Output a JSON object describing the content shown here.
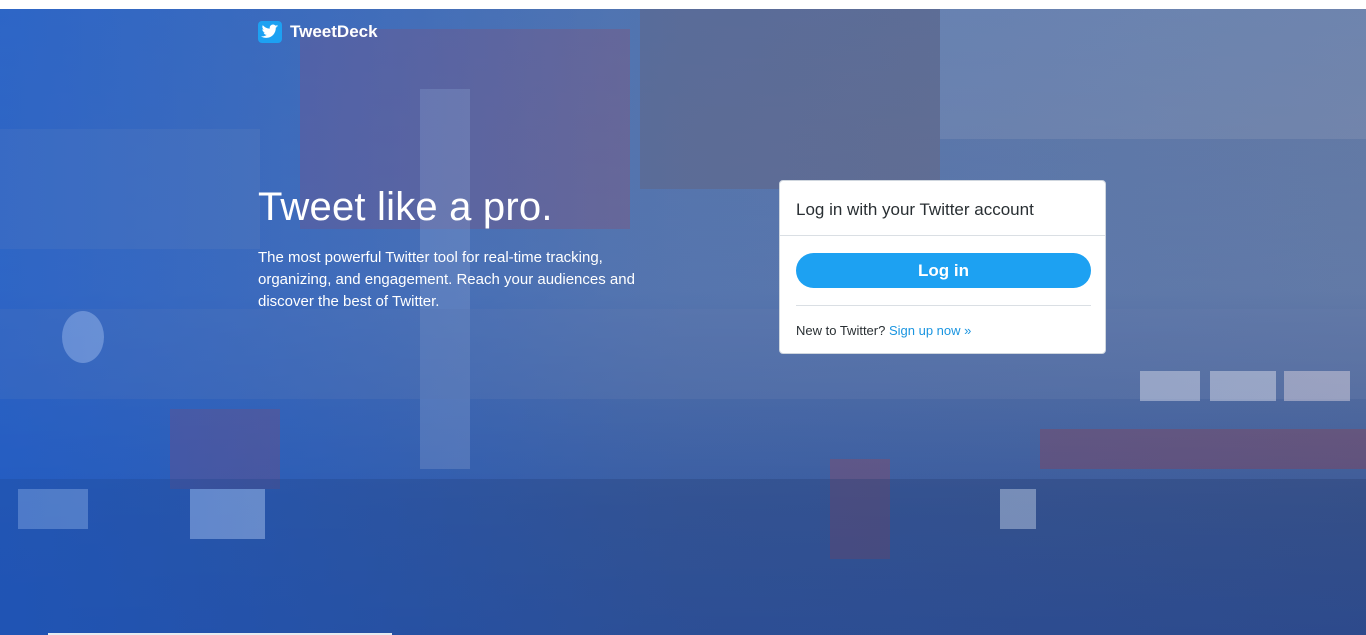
{
  "brand": {
    "logo_icon": "twitter-bird-icon",
    "name": "TweetDeck",
    "accent_color": "#1da1f2"
  },
  "hero": {
    "title": "Tweet like a pro.",
    "description": "The most powerful Twitter tool for real-time tracking, organizing, and engagement. Reach your audiences and discover the best of Twitter."
  },
  "login_card": {
    "heading": "Log in with your Twitter account",
    "login_button": "Log in",
    "new_prompt": "New to Twitter?",
    "signup_link": "Sign up now »"
  }
}
